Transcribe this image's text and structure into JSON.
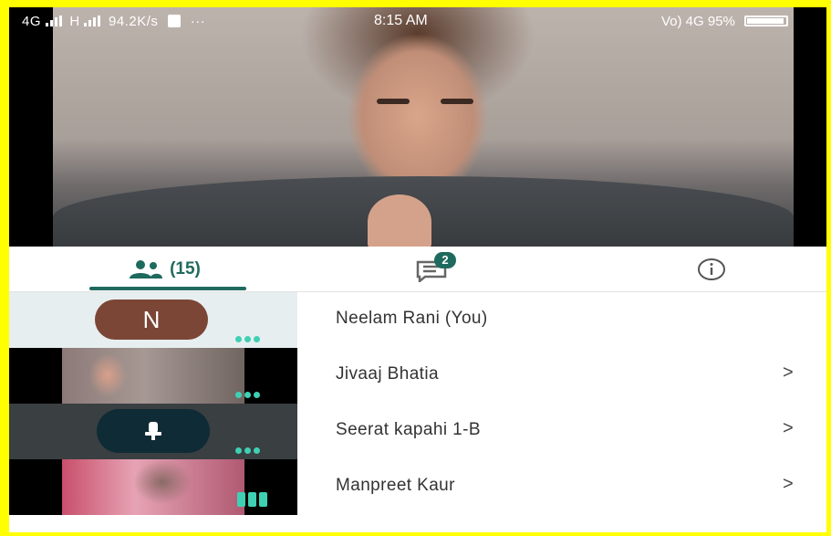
{
  "status_bar": {
    "left": "4G",
    "left2": "H",
    "speed": "94.2K/s",
    "more": "···",
    "time": "8:15 AM",
    "right": "Vo) 4G 95%"
  },
  "tabs": {
    "people_count": "(15)",
    "chat_badge": "2"
  },
  "participants": [
    {
      "name": "Neelam Rani (You)",
      "initial": "N",
      "tile": "avatar",
      "indicator": "dots",
      "chevron": ""
    },
    {
      "name": "Jivaaj Bhatia",
      "tile": "video",
      "indicator": "dots",
      "chevron": ">"
    },
    {
      "name": "Seerat kapahi 1-B",
      "tile": "muted",
      "indicator": "dots",
      "chevron": ">"
    },
    {
      "name": "Manpreet Kaur",
      "tile": "video",
      "indicator": "bars",
      "chevron": ">"
    }
  ],
  "colors": {
    "accent": "#1f6a5e",
    "indicator": "#3fd0b4",
    "avatar": "#7b4636",
    "frame": "#ffff00"
  }
}
